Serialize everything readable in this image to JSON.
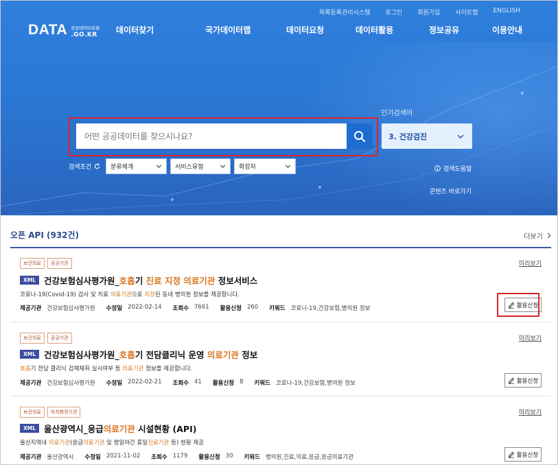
{
  "top_nav": [
    "목록등록관리시스템",
    "로그인",
    "회원가입",
    "사이트맵",
    "ENGLISH"
  ],
  "logo": {
    "main": "DATA",
    "sub_korean": "공공데이터포털",
    "sub_domain": ".GO.KR"
  },
  "main_nav": [
    "데이터찾기",
    "국가데이터맵",
    "데이터요청",
    "데이터활용",
    "정보공유",
    "이용안내"
  ],
  "search": {
    "placeholder": "어떤 공공데이터를 찾으시나요?"
  },
  "popular": {
    "label": "인기검색어",
    "current": "3. 건강검진"
  },
  "filters": {
    "label": "검색조건",
    "options": [
      "분류체계",
      "서비스유형",
      "확장자"
    ]
  },
  "help_link": "검색도움말",
  "shortcut_link": "콘텐츠 바로가기",
  "section": {
    "title": "오픈 API (932건)",
    "more": "더보기"
  },
  "cards": [
    {
      "tags": [
        "보건의료",
        "공공기관"
      ],
      "preview": "미리보기",
      "format": "XML",
      "title_parts": [
        {
          "t": "건강보험심사평가원_",
          "hl": false
        },
        {
          "t": "호흡",
          "hl": true
        },
        {
          "t": "기 ",
          "hl": false
        },
        {
          "t": "진료 지정 의료기관",
          "hl": true
        },
        {
          "t": " 정보서비스",
          "hl": false
        }
      ],
      "desc_parts": [
        {
          "t": "코로나-19(Covid-19) 검사 및 치료 ",
          "hl": false
        },
        {
          "t": "의료기관",
          "hl": true
        },
        {
          "t": "으로 ",
          "hl": false
        },
        {
          "t": "지정",
          "hl": true
        },
        {
          "t": "된 동네 병의원 정보를 제공합니다.",
          "hl": false
        }
      ],
      "meta": [
        {
          "k": "제공기관",
          "v": "건강보험심사평가원"
        },
        {
          "k": "수정일",
          "v": "2022-02-14"
        },
        {
          "k": "조회수",
          "v": "7661"
        },
        {
          "k": "활용신청",
          "v": "260"
        },
        {
          "k": "키워드",
          "v": "코로나-19,건강보험,병의원 정보"
        }
      ],
      "apply": "활용신청"
    },
    {
      "tags": [
        "보건의료",
        "공공기관"
      ],
      "preview": "미리보기",
      "format": "XML",
      "title_parts": [
        {
          "t": "건강보험심사평가원_",
          "hl": false
        },
        {
          "t": "호흡",
          "hl": true
        },
        {
          "t": "기 전담클리닉 운영 ",
          "hl": false
        },
        {
          "t": "의료기관",
          "hl": true
        },
        {
          "t": " 정보",
          "hl": false
        }
      ],
      "desc_parts": [
        {
          "t": "호흡",
          "hl": true
        },
        {
          "t": "기 전담 클리닉 검체채취 실시여부 등 ",
          "hl": false
        },
        {
          "t": "의료기관",
          "hl": true
        },
        {
          "t": " 정보를 제공합니다.",
          "hl": false
        }
      ],
      "meta": [
        {
          "k": "제공기관",
          "v": "건강보험심사평가원"
        },
        {
          "k": "수정일",
          "v": "2022-02-21"
        },
        {
          "k": "조회수",
          "v": "41"
        },
        {
          "k": "활용신청",
          "v": "8"
        },
        {
          "k": "키워드",
          "v": "코로나-19,건강보험,병의원 정보"
        }
      ],
      "apply": "활용신청"
    },
    {
      "tags": [
        "보건의료",
        "자치행정기관"
      ],
      "preview": "미리보기",
      "format": "XML",
      "title_parts": [
        {
          "t": "울산광역시_응급",
          "hl": false
        },
        {
          "t": "의료기관",
          "hl": true
        },
        {
          "t": " 시설현황 (API)",
          "hl": false
        }
      ],
      "desc_parts": [
        {
          "t": "울산지역내 ",
          "hl": false
        },
        {
          "t": "의료기관",
          "hl": true
        },
        {
          "t": "(응급",
          "hl": false
        },
        {
          "t": "의료기관",
          "hl": true
        },
        {
          "t": " 및 평일야간 휴일",
          "hl": false
        },
        {
          "t": "진료기관",
          "hl": true
        },
        {
          "t": " 등) 현황 제공",
          "hl": false
        }
      ],
      "meta": [
        {
          "k": "제공기관",
          "v": "울산광역시"
        },
        {
          "k": "수정일",
          "v": "2021-11-02"
        },
        {
          "k": "조회수",
          "v": "1179"
        },
        {
          "k": "활용신청",
          "v": "30"
        },
        {
          "k": "키워드",
          "v": "병의원,진료,의료,응급,응급의료기관"
        }
      ],
      "apply": "활용신청"
    }
  ]
}
